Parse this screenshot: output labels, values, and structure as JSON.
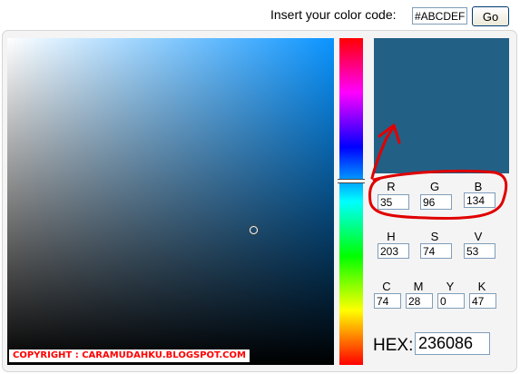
{
  "topbar": {
    "label": "Insert your color code:",
    "code_value": "#ABCDEF",
    "go_label": "Go"
  },
  "copyright": "COPYRIGHT : CARAMUDAHKU.BLOGSPOT.COM",
  "colors": {
    "selected": "#236086",
    "annotation": "#e00000",
    "copyright_text": "#ff0000"
  },
  "rgb": {
    "r_label": "R",
    "r_value": "35",
    "g_label": "G",
    "g_value": "96",
    "b_label": "B",
    "b_value": "134"
  },
  "hsv": {
    "h_label": "H",
    "h_value": "203",
    "s_label": "S",
    "s_value": "74",
    "v_label": "V",
    "v_value": "53"
  },
  "cmyk": {
    "c_label": "C",
    "c_value": "74",
    "m_label": "M",
    "m_value": "28",
    "y_label": "Y",
    "y_value": "0",
    "k_label": "K",
    "k_value": "47"
  },
  "hex": {
    "label": "HEX:",
    "value": "236086"
  },
  "annotations": {
    "circle": "red-hand-drawn-circle",
    "arrow": "red-hand-drawn-arrow"
  }
}
